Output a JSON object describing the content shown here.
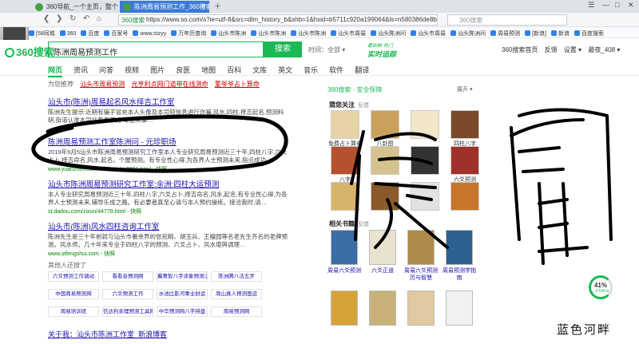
{
  "browser": {
    "tabs": [
      {
        "label": "360导航_一个主页，整个世界"
      },
      {
        "label": "陈洲周易预测工作_360搜索"
      }
    ],
    "url_site": "360搜索",
    "url": "https://www.so.com/s?ie=utf-8&src=dlm_history_b&shb=1&hsid=b5711c920a199064&ls=n580386de8b8",
    "top_search_placeholder": "360搜索",
    "bookmarks": [
      "[58同城",
      "360",
      "百度",
      "百家号",
      "www.stzyy",
      "万年历查询",
      "汕头市陈洲",
      "汕头市陈洲",
      "汕头市陈洲",
      "汕头市周易",
      "汕头陈洲问",
      "汕头市周易",
      "汕头陈洲问",
      "周易预测",
      "[新浪]",
      "新浪",
      "百度搜索"
    ]
  },
  "search": {
    "logo": "360搜索",
    "query": "陈洲周易预测工作",
    "button": "搜索",
    "time_filter": "时间：全部 ▾",
    "realtime_top": "最新鲜·热门",
    "realtime": "实时追踪",
    "header_links": [
      "360搜索首页",
      "反馈",
      "设置 ▾",
      "最夜_408 ▾"
    ]
  },
  "categories": [
    "网页",
    "资讯",
    "问答",
    "视频",
    "图片",
    "良医",
    "地图",
    "百科",
    "文库",
    "英文",
    "音乐",
    "软件",
    "翻译"
  ],
  "hint": {
    "text": "为您推荐",
    "links": [
      "汕头市周易预测",
      "元亨利贞网门道带在线测命",
      "董爷爷占卜算命"
    ]
  },
  "results": [
    {
      "title": "汕头市(陈洲)周易起名风水择吉工作室",
      "desc": "陈洲先生提示:近期有骗子冒充本人头像及本司短信息进行诈骗,风水,四柱,择吉起名,预测科研,街道认准本司站着页下方 专业从事…",
      "url": "www.chenzhou.com - 快照"
    },
    {
      "title": "陈洲周易预测工作室陈洲问 - 元珍职场",
      "desc": "2019年9月5汕头市陈洲周易预测研究工作室本人专业研究周易预测近三十年,四柱八字,六爻占卜,择吉命名,风水,起名。个屋预测。有专业性心得,为各界人士预测未来,指点成功…",
      "url": "www.yuanzhen.com/lele/article-8091.html - 快照"
    },
    {
      "title": "汕头市陈洲周易预测研究工作室:余洲:四柱大运预测",
      "desc": "本人专业研究周易预测近三十年,四柱八字,六爻占卜,择吉命名,风水,起名,有专业性心得,为各界人士预测未来,辅导乐成之路。有必要者真至心请与本人预约操练。接洽我时,请…",
      "url": "st.dadou.com/zixun/44778.html - 快照"
    },
    {
      "title": "汕头市(陈洲)风水四柱咨询工作室",
      "desc": "陈洲先生是三十年前就与汕头市署余界的张宛精、胡玉兵、王檀园等名老先生齐名的老牌预测。风水师。几十年来专业于四柱八字的预测、六爻占卜、风水堪舆调理…",
      "url": "www.stfengshui.com - 快照"
    }
  ],
  "also_searched": {
    "label": "其他人还搜了",
    "tags": [
      "六爻预测工作调动",
      "看看音预测网",
      "冀菁智八字读象预测法",
      "陈洲腾八法五步",
      "中国周易预测网",
      "六爻预测工作",
      "水池比影河事业财运",
      "周山真人预测面运",
      "周易培训班",
      "信达利余理预测工具网",
      "中华预测网八字排盘",
      "周易预测网"
    ]
  },
  "more_results": "关于我：汕头市陈洲工作室_新浪博客",
  "panel": {
    "brand": "360搜索 · 安全保障",
    "expand": "展开 ▾",
    "section1": "猜您关注",
    "section1_tag": "反馈",
    "thumbs": [
      "免费占卜算命",
      "八卦图",
      "",
      "四柱八字",
      "八字",
      "",
      "",
      "六爻预测",
      "",
      "",
      "",
      ""
    ],
    "section2": "相关书籍",
    "section2_tag": "反馈",
    "books_row1": [
      "周易六爻预测",
      "六爻正道",
      "周易六爻预测历与智慧",
      "周易预测学指南"
    ],
    "books_row2": [
      "",
      "",
      "",
      ""
    ]
  },
  "badge": {
    "percent": "41%",
    "speed": "↓ 4.53K/s"
  },
  "watermark": "蓝色河畔",
  "scribble_text": "假冒",
  "colors": {
    "brand_green": "#19b955",
    "link_blue": "#1a0dab",
    "url_green": "#008000"
  }
}
